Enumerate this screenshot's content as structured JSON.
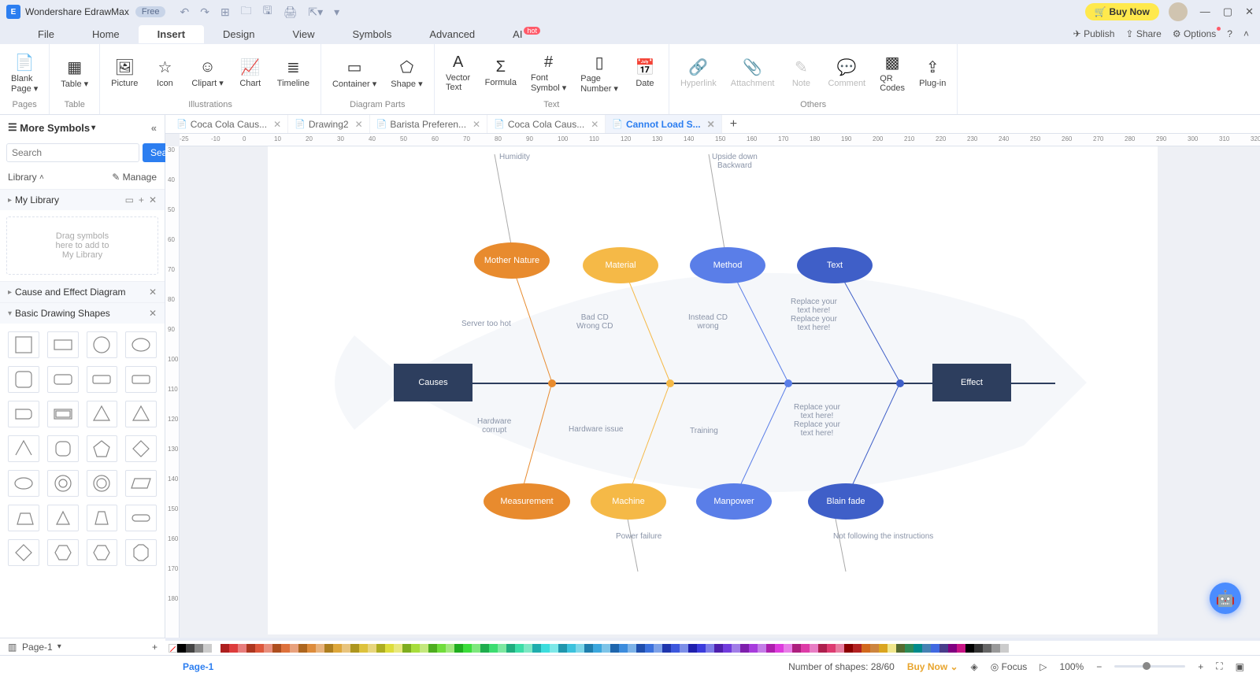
{
  "app": {
    "title": "Wondershare EdrawMax",
    "free_badge": "Free",
    "buy_now": "Buy Now"
  },
  "menu": {
    "tabs": [
      "File",
      "Home",
      "Insert",
      "Design",
      "View",
      "Symbols",
      "Advanced",
      "AI"
    ],
    "ai_hot": "hot",
    "right": {
      "publish": "Publish",
      "share": "Share",
      "options": "Options"
    }
  },
  "ribbon": {
    "groups": [
      {
        "label": "Pages",
        "items": [
          {
            "icon": "📄",
            "label": "Blank\nPage ▾"
          }
        ]
      },
      {
        "label": "Table",
        "items": [
          {
            "icon": "▦",
            "label": "Table ▾"
          }
        ]
      },
      {
        "label": "Illustrations",
        "items": [
          {
            "icon": "🖼",
            "label": "Picture"
          },
          {
            "icon": "☆",
            "label": "Icon"
          },
          {
            "icon": "☺",
            "label": "Clipart ▾"
          },
          {
            "icon": "📈",
            "label": "Chart"
          },
          {
            "icon": "≣",
            "label": "Timeline"
          }
        ]
      },
      {
        "label": "Diagram Parts",
        "items": [
          {
            "icon": "▭",
            "label": "Container ▾"
          },
          {
            "icon": "⬠",
            "label": "Shape ▾"
          }
        ]
      },
      {
        "label": "Text",
        "items": [
          {
            "icon": "A",
            "label": "Vector\nText"
          },
          {
            "icon": "Σ",
            "label": "Formula"
          },
          {
            "icon": "#",
            "label": "Font\nSymbol ▾"
          },
          {
            "icon": "▯",
            "label": "Page\nNumber ▾"
          },
          {
            "icon": "📅",
            "label": "Date"
          }
        ]
      },
      {
        "label": "Others",
        "items": [
          {
            "icon": "🔗",
            "label": "Hyperlink",
            "disabled": true
          },
          {
            "icon": "📎",
            "label": "Attachment",
            "disabled": true
          },
          {
            "icon": "✎",
            "label": "Note",
            "disabled": true
          },
          {
            "icon": "💬",
            "label": "Comment",
            "disabled": true
          },
          {
            "icon": "▩",
            "label": "QR\nCodes"
          },
          {
            "icon": "⇪",
            "label": "Plug-in"
          }
        ]
      }
    ]
  },
  "left_panel": {
    "header": "More Symbols",
    "search_placeholder": "Search",
    "search_btn": "Search",
    "library": "Library",
    "manage": "Manage",
    "sections": {
      "mylib": "My Library",
      "drop_hint": "Drag symbols\nhere to add to\nMy Library",
      "cause": "Cause and Effect Diagram",
      "basic": "Basic Drawing Shapes"
    }
  },
  "doc_tabs": [
    {
      "label": "Coca Cola Caus..."
    },
    {
      "label": "Drawing2"
    },
    {
      "label": "Barista Preferen..."
    },
    {
      "label": "Coca Cola Caus..."
    },
    {
      "label": "Cannot Load S...",
      "active": true
    }
  ],
  "diagram": {
    "causes": "Causes",
    "effect": "Effect",
    "top": [
      "Mother\nNature",
      "Material",
      "Method",
      "Text"
    ],
    "bottom": [
      "Measurement",
      "Machine",
      "Manpower",
      "Blain fade"
    ],
    "labels": {
      "humidity": "Humidity",
      "upside": "Upside down\nBackward",
      "servhot": "Server too hot",
      "badcd": "Bad CD\nWrong CD",
      "instead": "Instead CD\nwrong",
      "replace1": "Replace your\ntext here!\nReplace your\ntext here!",
      "hwcorrupt": "Hardware\ncorrupt",
      "hwissue": "Hardware issue",
      "training": "Training",
      "replace2": "Replace your\ntext here!\nReplace your\ntext here!",
      "power": "Power failure",
      "notfollow": "Not following the instructions"
    }
  },
  "status": {
    "page_tab": "Page-1",
    "page_label": "Page-1",
    "shapes": "Number of shapes: 28/60",
    "buy": "Buy Now",
    "focus": "Focus",
    "zoom": "100%"
  },
  "ruler_h": [
    "-25",
    "-10",
    "0",
    "10",
    "20",
    "30",
    "40",
    "50",
    "60",
    "70",
    "80",
    "90",
    "100",
    "110",
    "120",
    "130",
    "140",
    "150",
    "160",
    "170",
    "180",
    "190",
    "200",
    "210",
    "220",
    "230",
    "240",
    "250",
    "260",
    "270",
    "280",
    "290",
    "300",
    "310",
    "320"
  ],
  "ruler_v": [
    "30",
    "40",
    "50",
    "60",
    "70",
    "80",
    "90",
    "100",
    "110",
    "120",
    "130",
    "140",
    "150",
    "160",
    "170",
    "180"
  ]
}
